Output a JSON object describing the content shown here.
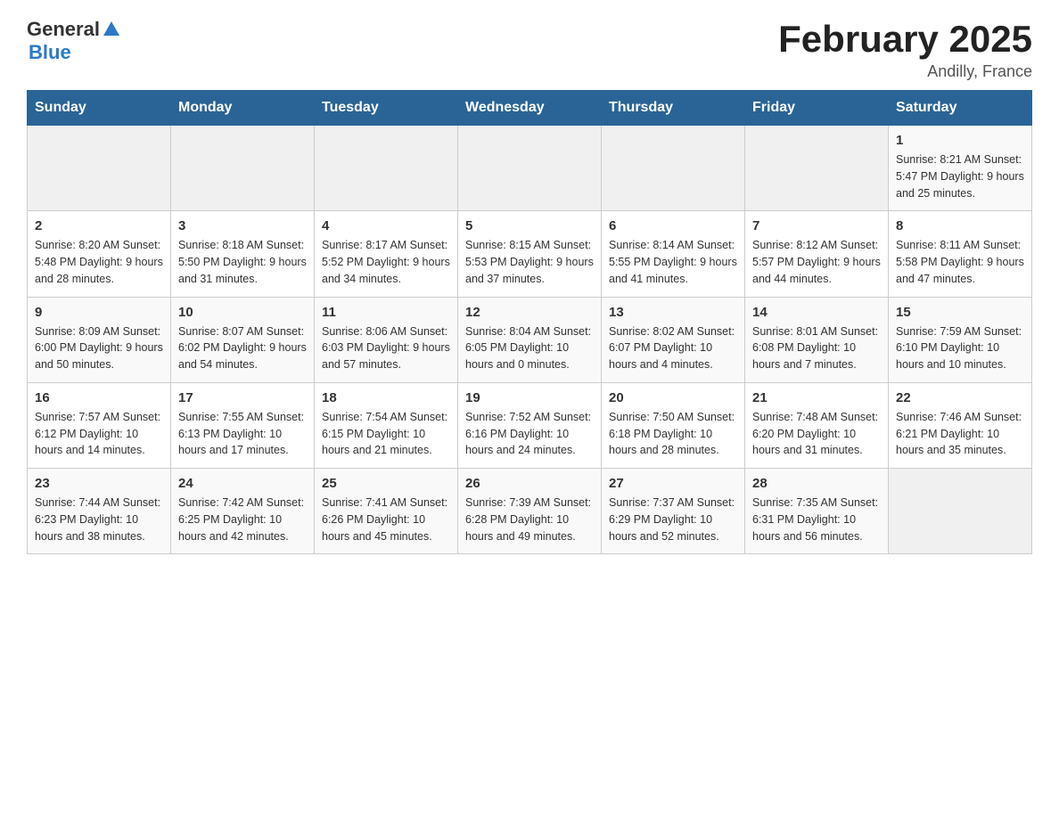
{
  "header": {
    "logo_general": "General",
    "logo_blue": "Blue",
    "title": "February 2025",
    "subtitle": "Andilly, France"
  },
  "days_of_week": [
    "Sunday",
    "Monday",
    "Tuesday",
    "Wednesday",
    "Thursday",
    "Friday",
    "Saturday"
  ],
  "weeks": [
    [
      {
        "day": "",
        "info": ""
      },
      {
        "day": "",
        "info": ""
      },
      {
        "day": "",
        "info": ""
      },
      {
        "day": "",
        "info": ""
      },
      {
        "day": "",
        "info": ""
      },
      {
        "day": "",
        "info": ""
      },
      {
        "day": "1",
        "info": "Sunrise: 8:21 AM\nSunset: 5:47 PM\nDaylight: 9 hours and 25 minutes."
      }
    ],
    [
      {
        "day": "2",
        "info": "Sunrise: 8:20 AM\nSunset: 5:48 PM\nDaylight: 9 hours and 28 minutes."
      },
      {
        "day": "3",
        "info": "Sunrise: 8:18 AM\nSunset: 5:50 PM\nDaylight: 9 hours and 31 minutes."
      },
      {
        "day": "4",
        "info": "Sunrise: 8:17 AM\nSunset: 5:52 PM\nDaylight: 9 hours and 34 minutes."
      },
      {
        "day": "5",
        "info": "Sunrise: 8:15 AM\nSunset: 5:53 PM\nDaylight: 9 hours and 37 minutes."
      },
      {
        "day": "6",
        "info": "Sunrise: 8:14 AM\nSunset: 5:55 PM\nDaylight: 9 hours and 41 minutes."
      },
      {
        "day": "7",
        "info": "Sunrise: 8:12 AM\nSunset: 5:57 PM\nDaylight: 9 hours and 44 minutes."
      },
      {
        "day": "8",
        "info": "Sunrise: 8:11 AM\nSunset: 5:58 PM\nDaylight: 9 hours and 47 minutes."
      }
    ],
    [
      {
        "day": "9",
        "info": "Sunrise: 8:09 AM\nSunset: 6:00 PM\nDaylight: 9 hours and 50 minutes."
      },
      {
        "day": "10",
        "info": "Sunrise: 8:07 AM\nSunset: 6:02 PM\nDaylight: 9 hours and 54 minutes."
      },
      {
        "day": "11",
        "info": "Sunrise: 8:06 AM\nSunset: 6:03 PM\nDaylight: 9 hours and 57 minutes."
      },
      {
        "day": "12",
        "info": "Sunrise: 8:04 AM\nSunset: 6:05 PM\nDaylight: 10 hours and 0 minutes."
      },
      {
        "day": "13",
        "info": "Sunrise: 8:02 AM\nSunset: 6:07 PM\nDaylight: 10 hours and 4 minutes."
      },
      {
        "day": "14",
        "info": "Sunrise: 8:01 AM\nSunset: 6:08 PM\nDaylight: 10 hours and 7 minutes."
      },
      {
        "day": "15",
        "info": "Sunrise: 7:59 AM\nSunset: 6:10 PM\nDaylight: 10 hours and 10 minutes."
      }
    ],
    [
      {
        "day": "16",
        "info": "Sunrise: 7:57 AM\nSunset: 6:12 PM\nDaylight: 10 hours and 14 minutes."
      },
      {
        "day": "17",
        "info": "Sunrise: 7:55 AM\nSunset: 6:13 PM\nDaylight: 10 hours and 17 minutes."
      },
      {
        "day": "18",
        "info": "Sunrise: 7:54 AM\nSunset: 6:15 PM\nDaylight: 10 hours and 21 minutes."
      },
      {
        "day": "19",
        "info": "Sunrise: 7:52 AM\nSunset: 6:16 PM\nDaylight: 10 hours and 24 minutes."
      },
      {
        "day": "20",
        "info": "Sunrise: 7:50 AM\nSunset: 6:18 PM\nDaylight: 10 hours and 28 minutes."
      },
      {
        "day": "21",
        "info": "Sunrise: 7:48 AM\nSunset: 6:20 PM\nDaylight: 10 hours and 31 minutes."
      },
      {
        "day": "22",
        "info": "Sunrise: 7:46 AM\nSunset: 6:21 PM\nDaylight: 10 hours and 35 minutes."
      }
    ],
    [
      {
        "day": "23",
        "info": "Sunrise: 7:44 AM\nSunset: 6:23 PM\nDaylight: 10 hours and 38 minutes."
      },
      {
        "day": "24",
        "info": "Sunrise: 7:42 AM\nSunset: 6:25 PM\nDaylight: 10 hours and 42 minutes."
      },
      {
        "day": "25",
        "info": "Sunrise: 7:41 AM\nSunset: 6:26 PM\nDaylight: 10 hours and 45 minutes."
      },
      {
        "day": "26",
        "info": "Sunrise: 7:39 AM\nSunset: 6:28 PM\nDaylight: 10 hours and 49 minutes."
      },
      {
        "day": "27",
        "info": "Sunrise: 7:37 AM\nSunset: 6:29 PM\nDaylight: 10 hours and 52 minutes."
      },
      {
        "day": "28",
        "info": "Sunrise: 7:35 AM\nSunset: 6:31 PM\nDaylight: 10 hours and 56 minutes."
      },
      {
        "day": "",
        "info": ""
      }
    ]
  ]
}
